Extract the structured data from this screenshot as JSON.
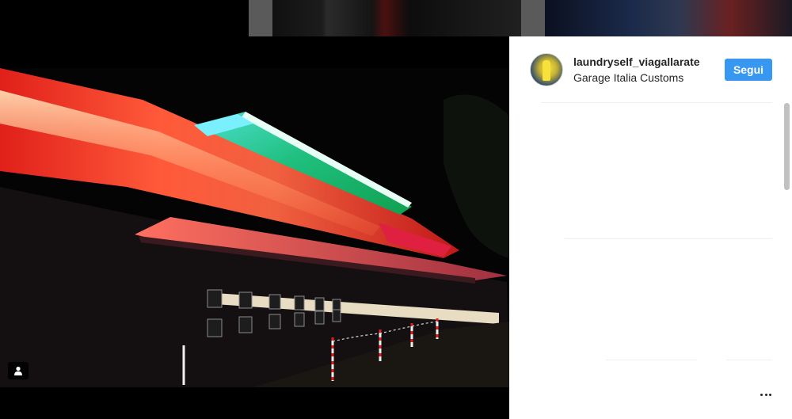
{
  "post": {
    "username": "laundryself_viagallarate",
    "location": "Garage Italia Customs",
    "follow_label": "Segui",
    "more_icon": "more-horizontal-icon",
    "tag_icon": "user-tag-icon"
  },
  "colors": {
    "follow_button": "#3897f0",
    "text": "#262626",
    "divider": "#efefef",
    "panel_bg": "#ffffff",
    "photo_bg": "#000000"
  }
}
